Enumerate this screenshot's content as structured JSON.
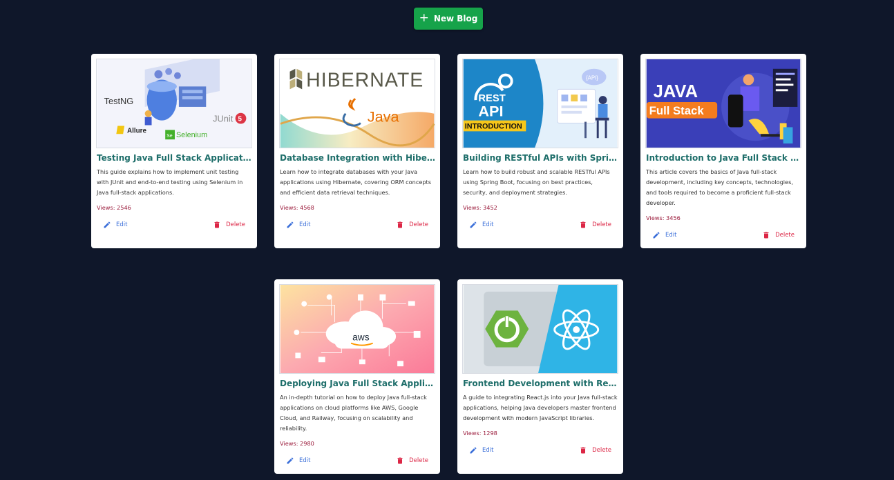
{
  "toolbar": {
    "new_label": "New Blog"
  },
  "actions": {
    "edit": "Edit",
    "delete": "Delete"
  },
  "colors": {
    "background": "#0f172a",
    "primary": "#16a34a",
    "title": "#1e6e6a",
    "edit": "#3b6fd9",
    "delete": "#dc2645",
    "views": "#9b1c3c"
  },
  "posts": [
    {
      "title": "Testing Java Full Stack Applications with JUnit and Selenium",
      "description": "This guide explains how to implement unit testing with JUnit and end-to-end testing using Selenium in Java full-stack applications.",
      "views": "Views: 2546",
      "image": {
        "labels": [
          "TestNG",
          "JUnit",
          "5",
          "Allure",
          "Selenium",
          "Se"
        ]
      }
    },
    {
      "title": "Database Integration with Hibernate for Java Applications",
      "description": "Learn how to integrate databases with your Java applications using Hibernate, covering ORM concepts and efficient data retrieval techniques.",
      "views": "Views: 4568",
      "image": {
        "labels": [
          "HIBERNATE",
          "Java"
        ]
      }
    },
    {
      "title": "Building RESTful APIs with Spring Boot",
      "description": "Learn how to build robust and scalable RESTful APIs using Spring Boot, focusing on best practices, security, and deployment strategies.",
      "views": "Views: 3452",
      "image": {
        "labels": [
          "REST",
          "API",
          "INTRODUCTION",
          "{API}"
        ]
      }
    },
    {
      "title": "Introduction to Java Full Stack Development",
      "description": "This article covers the basics of Java full-stack development, including key concepts, technologies, and tools required to become a proficient full-stack developer.",
      "views": "Views: 3456",
      "image": {
        "labels": [
          "JAVA",
          "Full Stack"
        ]
      }
    },
    {
      "title": "Deploying Java Full Stack Applications on Cloud Platforms",
      "description": "An in-depth tutorial on how to deploy Java full-stack applications on cloud platforms like AWS, Google Cloud, and Railway, focusing on scalability and reliability.",
      "views": "Views: 2980",
      "image": {
        "labels": [
          "aws"
        ]
      }
    },
    {
      "title": "Frontend Development with React for Java Developers",
      "description": "A guide to integrating React.js into your Java full-stack applications, helping Java developers master frontend development with modern JavaScript libraries.",
      "views": "Views: 1298",
      "image": {
        "labels": []
      }
    }
  ]
}
